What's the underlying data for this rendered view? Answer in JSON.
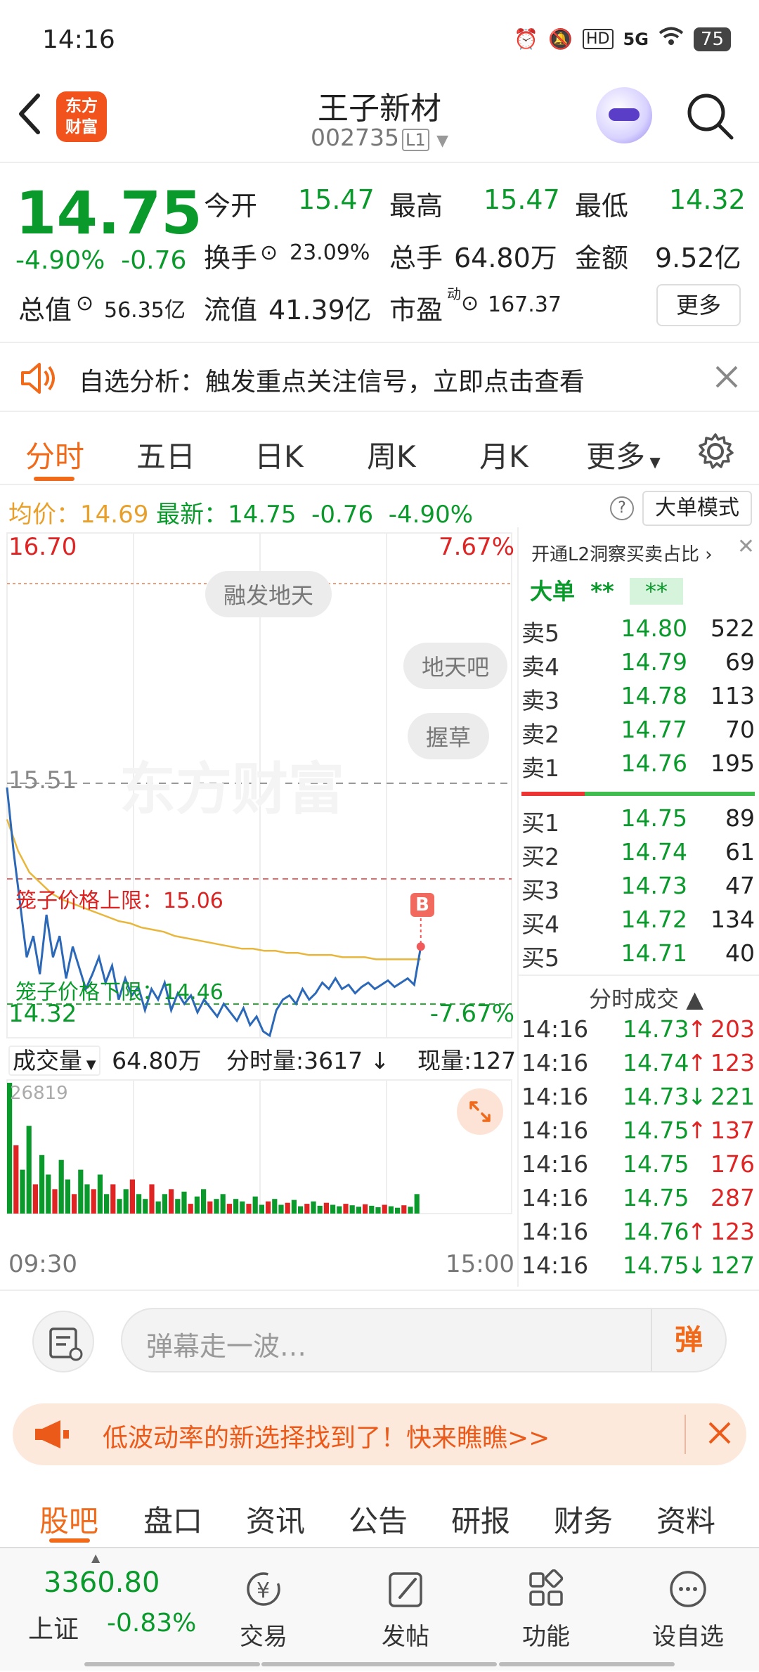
{
  "status_bar": {
    "time": "14:16",
    "network": "5G",
    "hd": "HD",
    "battery": "75"
  },
  "header": {
    "logo_text": [
      "东方",
      "财富"
    ],
    "title": "王子新材",
    "code": "002735",
    "level_badge": "L1"
  },
  "quote": {
    "price": "14.75",
    "change_pct": "-4.90%",
    "change": "-0.76",
    "open_label": "今开",
    "open": "15.47",
    "high_label": "最高",
    "high": "15.47",
    "low_label": "最低",
    "low": "14.32",
    "turnover_label": "换手",
    "turnover": "23.09%",
    "volume_label": "总手",
    "volume": "64.80万",
    "amount_label": "金额",
    "amount": "9.52亿",
    "mcap_label": "总值",
    "mcap": "56.35亿",
    "float_label": "流值",
    "float_cap": "41.39亿",
    "pe_label": "市盈",
    "pe_sup": "动",
    "pe": "167.37",
    "more_label": "更多"
  },
  "notice": {
    "text": "自选分析：触发重点关注信号，立即点击查看"
  },
  "chart_tabs": [
    "分时",
    "五日",
    "日K",
    "周K",
    "月K",
    "更多"
  ],
  "avg_row": {
    "avg_label": "均价：",
    "avg": "14.69",
    "last_label": "最新：",
    "last": "14.75",
    "chg": "-0.76",
    "pct": "-4.90%",
    "mode_label": "大单模式"
  },
  "chart_labels": {
    "top_price": "16.70",
    "top_pct": "7.67%",
    "bottom_price": "14.32",
    "bottom_pct": "-7.67%",
    "ref_price": "15.51",
    "cage_upper": "笼子价格上限：15.06",
    "cage_lower": "笼子价格下限：14.46",
    "bubbles": [
      "融发地天",
      "地天吧",
      "握草"
    ],
    "watermark": "东方财富",
    "b_marker": "B"
  },
  "volume_row": {
    "label": "成交量",
    "total": "64.80万",
    "minute_label": "分时量:3617 ↓",
    "now_label": "现量:127",
    "max_vol": "26819",
    "start_time": "09:30",
    "end_time": "15:00"
  },
  "chart_data": {
    "type": "line",
    "title": "",
    "xlabel": "",
    "ylabel": "",
    "ylim": [
      14.32,
      16.7
    ],
    "xlim": [
      "09:30",
      "15:00"
    ],
    "reference_close": 15.51,
    "cage_upper": 15.06,
    "cage_lower": 14.46,
    "series": [
      {
        "kind": "price",
        "values": [
          15.5,
          15.2,
          14.95,
          14.7,
          14.8,
          14.62,
          14.9,
          14.7,
          14.8,
          14.6,
          14.75,
          14.65,
          14.55,
          14.62,
          14.7,
          14.58,
          14.66,
          14.5,
          14.6,
          14.52,
          14.56,
          14.45,
          14.55,
          14.5,
          14.58,
          14.45,
          14.53,
          14.48,
          14.52,
          14.44,
          14.5,
          14.46,
          14.42,
          14.48,
          14.44,
          14.4,
          14.46,
          14.38,
          14.42,
          14.35,
          14.33,
          14.45,
          14.5,
          14.52,
          14.48,
          14.55,
          14.5,
          14.53,
          14.58,
          14.55,
          14.6,
          14.55,
          14.57,
          14.53,
          14.56,
          14.58,
          14.55,
          14.57,
          14.59,
          14.56,
          14.58,
          14.6,
          14.57,
          14.75
        ]
      },
      {
        "kind": "average",
        "values": [
          15.35,
          15.2,
          15.1,
          15.05,
          15.0,
          14.97,
          14.95,
          14.93,
          14.91,
          14.89,
          14.87,
          14.86,
          14.84,
          14.83,
          14.82,
          14.8,
          14.79,
          14.78,
          14.77,
          14.76,
          14.75,
          14.74,
          14.74,
          14.73,
          14.73,
          14.72,
          14.72,
          14.71,
          14.71,
          14.71,
          14.7,
          14.7,
          14.7,
          14.69,
          14.69,
          14.69,
          14.69,
          14.69
        ]
      }
    ],
    "volume": [
      26819,
      14000,
      9000,
      18000,
      6000,
      12000,
      8000,
      5000,
      11000,
      7000,
      4000,
      9000,
      6000,
      5000,
      8000,
      4000,
      6000,
      3000,
      5000,
      7000,
      4000,
      3000,
      6000,
      2500,
      4000,
      5000,
      3000,
      4500,
      2000,
      3500,
      5000,
      2500,
      3000,
      4000,
      2000,
      3000,
      2500,
      2000,
      3500,
      1800,
      2500,
      3000,
      1800,
      2200,
      2800,
      1500,
      2000,
      2500,
      1600,
      2200,
      1800,
      1500,
      2000,
      1700,
      1400,
      1900,
      1600,
      1300,
      1800,
      1500,
      1200,
      1700,
      1400,
      4000
    ],
    "volume_colors": [
      "#0a9a2b",
      "#e02424"
    ],
    "price_color": "#2c68b8",
    "average_color": "#e8b63a"
  },
  "order_book": {
    "header": "开通L2洞察买卖占比",
    "big_label": "大单",
    "big_a": "**",
    "big_b": "**",
    "asks": [
      {
        "name": "卖5",
        "price": "14.80",
        "vol": "522"
      },
      {
        "name": "卖4",
        "price": "14.79",
        "vol": "69"
      },
      {
        "name": "卖3",
        "price": "14.78",
        "vol": "113"
      },
      {
        "name": "卖2",
        "price": "14.77",
        "vol": "70"
      },
      {
        "name": "卖1",
        "price": "14.76",
        "vol": "195"
      }
    ],
    "bids": [
      {
        "name": "买1",
        "price": "14.75",
        "vol": "89"
      },
      {
        "name": "买2",
        "price": "14.74",
        "vol": "61"
      },
      {
        "name": "买3",
        "price": "14.73",
        "vol": "47"
      },
      {
        "name": "买4",
        "price": "14.72",
        "vol": "134"
      },
      {
        "name": "买5",
        "price": "14.71",
        "vol": "40"
      }
    ],
    "ticks_label": "分时成交",
    "ticks": [
      {
        "time": "14:16",
        "price": "14.73",
        "arrow": "↑",
        "vol": "203",
        "color": "red"
      },
      {
        "time": "14:16",
        "price": "14.74",
        "arrow": "↑",
        "vol": "123",
        "color": "red"
      },
      {
        "time": "14:16",
        "price": "14.73",
        "arrow": "↓",
        "vol": "221",
        "color": "green"
      },
      {
        "time": "14:16",
        "price": "14.75",
        "arrow": "↑",
        "vol": "137",
        "color": "red"
      },
      {
        "time": "14:16",
        "price": "14.75",
        "arrow": "",
        "vol": "176",
        "color": "red"
      },
      {
        "time": "14:16",
        "price": "14.75",
        "arrow": "",
        "vol": "287",
        "color": "red"
      },
      {
        "time": "14:16",
        "price": "14.76",
        "arrow": "↑",
        "vol": "123",
        "color": "red"
      },
      {
        "time": "14:16",
        "price": "14.75",
        "arrow": "↓",
        "vol": "127",
        "color": "green"
      }
    ]
  },
  "comment": {
    "placeholder": "弹幕走一波…",
    "dan": "弹"
  },
  "promo": {
    "text": "低波动率的新选择找到了！快来瞧瞧>>"
  },
  "sub_tabs": [
    "股吧",
    "盘口",
    "资讯",
    "公告",
    "研报",
    "财务",
    "资料"
  ],
  "bottom_nav": {
    "index_value": "3360.80",
    "index_name": "上证",
    "index_change": "-0.83%",
    "items": [
      "交易",
      "发帖",
      "功能",
      "设自选"
    ]
  }
}
